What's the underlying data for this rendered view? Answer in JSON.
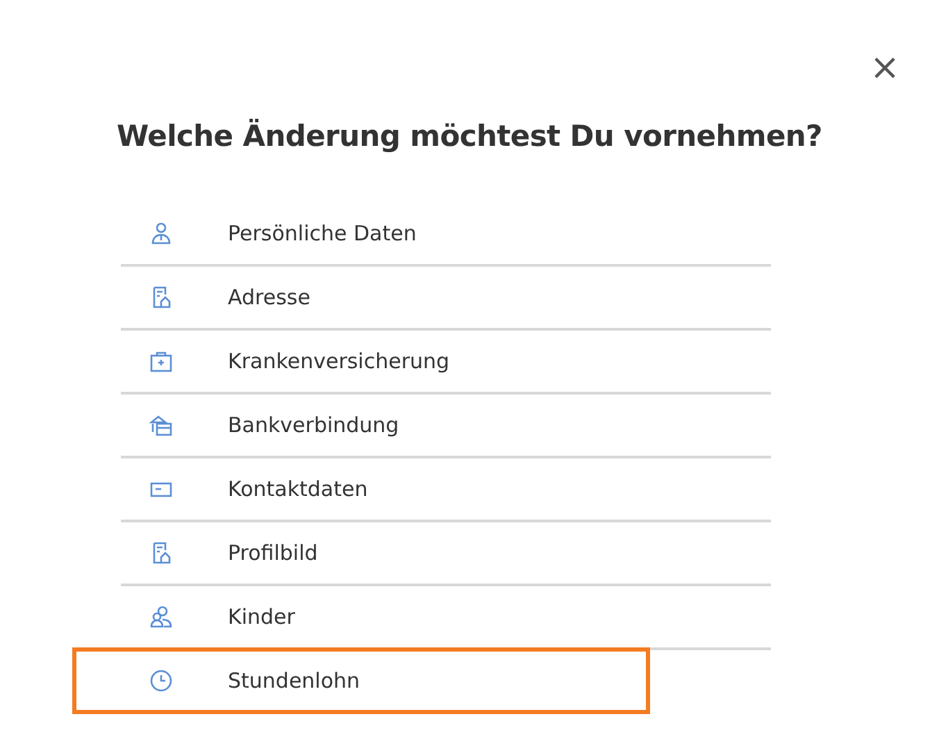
{
  "dialog": {
    "close": "×",
    "title": "Welche Änderung möchtest Du vornehmen?"
  },
  "options": [
    {
      "label": "Persönliche Daten",
      "kind": "person",
      "highlighted": false
    },
    {
      "label": "Adresse",
      "kind": "document",
      "highlighted": false
    },
    {
      "label": "Krankenversicherung",
      "kind": "medical",
      "highlighted": false
    },
    {
      "label": "Bankverbindung",
      "kind": "bank",
      "highlighted": false
    },
    {
      "label": "Kontaktdaten",
      "kind": "card",
      "highlighted": false
    },
    {
      "label": "Profilbild",
      "kind": "document",
      "highlighted": false
    },
    {
      "label": "Kinder",
      "kind": "people",
      "highlighted": false
    },
    {
      "label": "Stundenlohn",
      "kind": "clock",
      "highlighted": true
    }
  ]
}
